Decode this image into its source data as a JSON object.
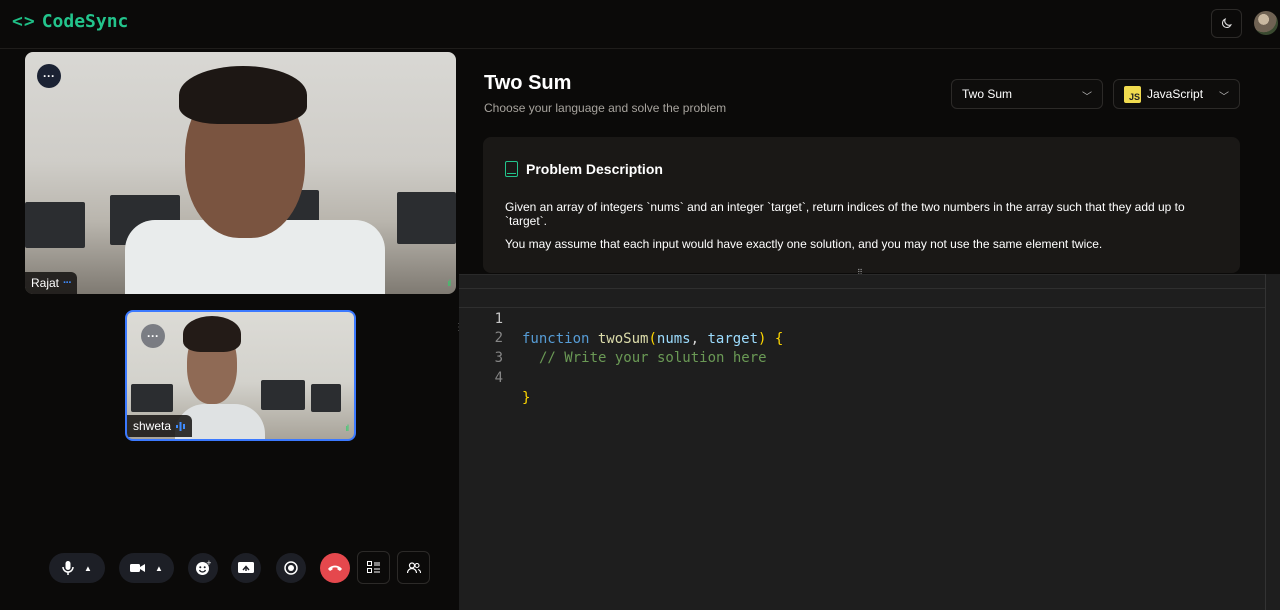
{
  "app": {
    "logo_glyph": "<>",
    "name": "CodeSync",
    "accent": "#23c48c"
  },
  "header": {
    "theme_icon": "moon-icon"
  },
  "call": {
    "main_participant": {
      "name": "Rajat",
      "status_dots": "···"
    },
    "second_participant": {
      "name": "shweta"
    },
    "signal_glyph": "ıl",
    "controls": {
      "mic": "mic-icon",
      "camera": "camera-icon",
      "reactions": "emoji-icon",
      "screen_share": "screen-share-icon",
      "record": "record-icon",
      "end_call": "phone-end-icon",
      "layout": "layout-icon",
      "participants": "participants-icon"
    }
  },
  "problem": {
    "title": "Two Sum",
    "subtitle": "Choose your language and solve the problem",
    "selected_problem": "Two Sum",
    "selected_language": "JavaScript",
    "language_badge": "JS",
    "description_heading": "Problem Description",
    "paragraphs": [
      "Given an array of integers `nums` and an integer `target`, return indices of the two numbers in the array such that they add up to `target`.",
      "You may assume that each input would have exactly one solution, and you may not use the same element twice."
    ]
  },
  "editor": {
    "line_numbers": [
      "1",
      "2",
      "3",
      "4"
    ],
    "line1": {
      "kw": "function",
      "name": "twoSum",
      "open": "(",
      "p1": "nums",
      "comma": ", ",
      "p2": "target",
      "close": ")",
      "brace": "{"
    },
    "line2": {
      "comment": "// Write your solution here"
    },
    "line4": {
      "brace": "}"
    }
  }
}
